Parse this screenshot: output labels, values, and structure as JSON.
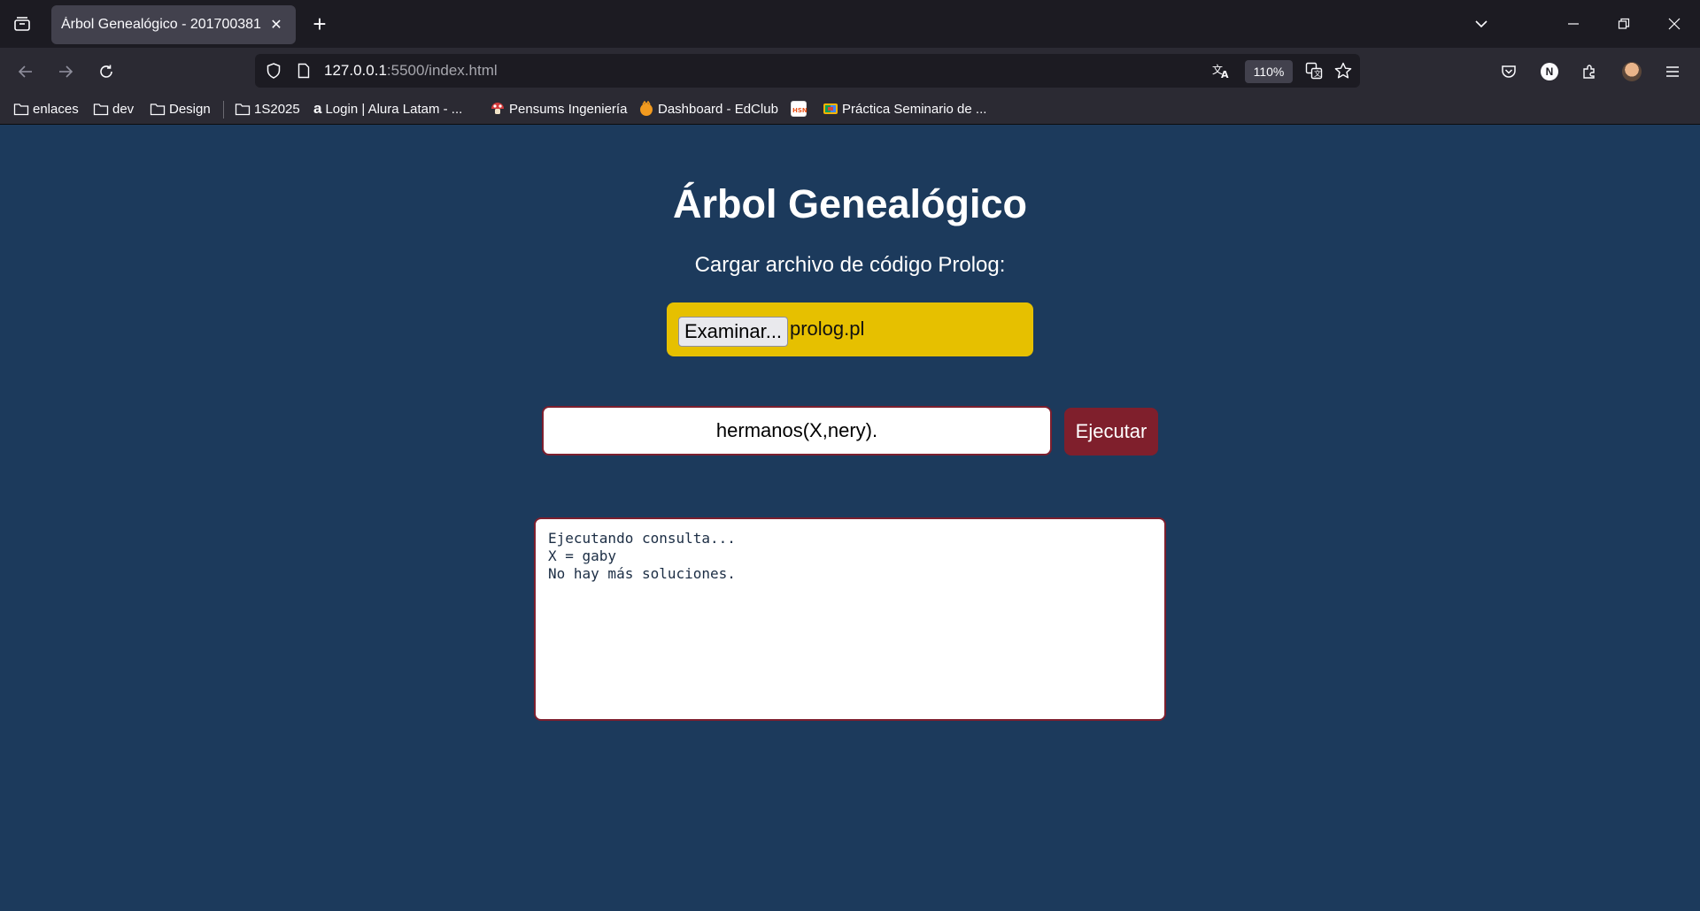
{
  "browser": {
    "tab_title": "Árbol Genealógico - 201700381",
    "url_host": "127.0.0.1",
    "url_rest": ":5500/index.html",
    "zoom": "110%",
    "bookmarks": [
      {
        "label": "enlaces",
        "icon": "folder-icon"
      },
      {
        "label": "dev",
        "icon": "folder-icon"
      },
      {
        "label": "Design",
        "icon": "folder-icon"
      },
      {
        "label": "1S2025",
        "icon": "folder-icon"
      },
      {
        "label": "Login | Alura Latam - ...",
        "icon": "alura-icon"
      },
      {
        "label": "Pensums Ingeniería",
        "icon": "mushroom-icon"
      },
      {
        "label": "Dashboard - EdClub",
        "icon": "edclub-icon"
      },
      {
        "label": "",
        "icon": "hsn-icon"
      },
      {
        "label": "Práctica Seminario de ...",
        "icon": "colab-icon"
      }
    ]
  },
  "page": {
    "title": "Árbol Genealógico",
    "subtitle": "Cargar archivo de código Prolog:",
    "file_button": "Examinar...",
    "file_name": "prolog.pl",
    "query_value": "hermanos(X,nery).",
    "run_button": "Ejecutar",
    "output_lines": [
      "Ejecutando consulta...",
      "X = gaby",
      "No hay más soluciones."
    ]
  },
  "colors": {
    "background": "#1c3a5c",
    "file_box": "#e6c000",
    "accent": "#7f1f2c"
  }
}
